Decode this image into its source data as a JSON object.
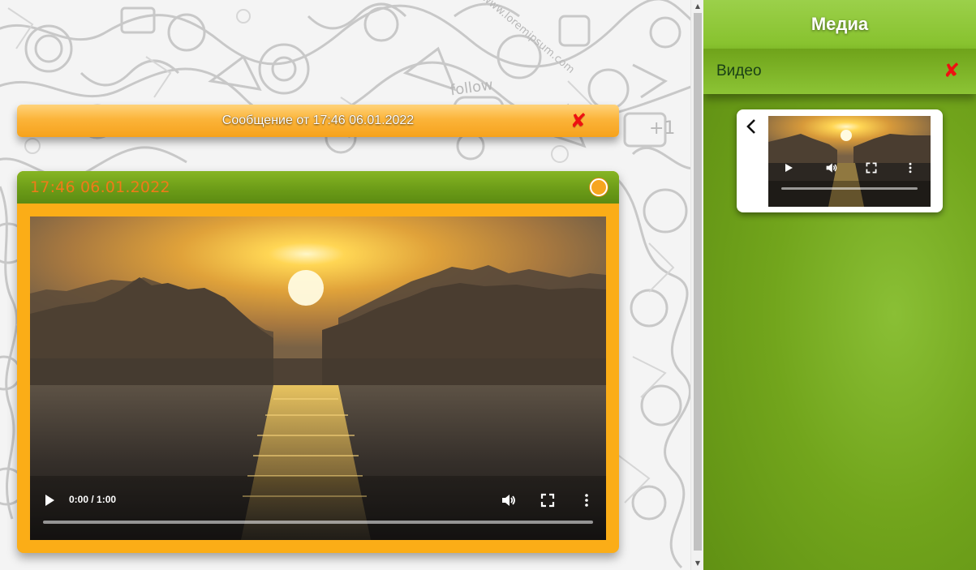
{
  "message": {
    "header_title": "Сообщение от 17:46 06.01.2022",
    "close_glyph": "✘",
    "card_time": "17:46 06.01.2022",
    "status_icon": "status-circle-icon"
  },
  "video": {
    "time_display": "0:00 / 1:00",
    "progress": 0,
    "controls": [
      "play-icon",
      "volume-icon",
      "fullscreen-icon",
      "more-options-icon"
    ]
  },
  "media_panel": {
    "title": "Медиа",
    "section_title": "Видео",
    "close_glyph": "✘",
    "back_glyph": "‹",
    "thumbnail_controls": [
      "play-icon",
      "volume-icon",
      "fullscreen-icon",
      "more-options-icon"
    ]
  },
  "background": {
    "doodle_text": [
      "www.loremipsum.com",
      "follow",
      "+1"
    ]
  },
  "colors": {
    "accent_orange": "#fbad17",
    "header_green": "#6a9a17",
    "panel_green": "#72a51c",
    "close_red": "#ee1111",
    "time_orange": "#f07a18"
  }
}
